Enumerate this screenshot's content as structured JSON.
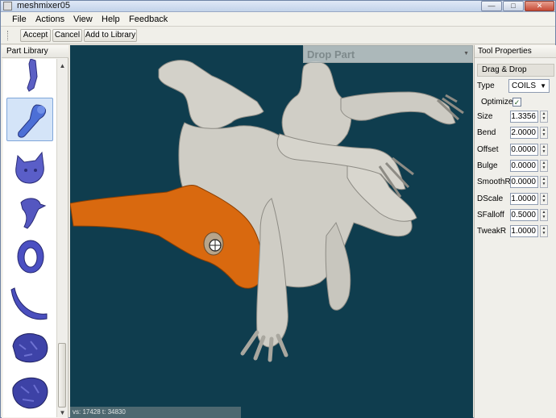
{
  "window": {
    "title": "meshmixer05"
  },
  "menu": {
    "items": [
      "File",
      "Actions",
      "View",
      "Help",
      "Feedback"
    ]
  },
  "toolbar": {
    "accept": "Accept",
    "cancel": "Cancel",
    "add_to_library": "Add to Library"
  },
  "part_library": {
    "title": "Part Library",
    "parts": [
      {
        "icon": "leg-part-icon",
        "selected": false
      },
      {
        "icon": "arm-part-icon",
        "selected": true
      },
      {
        "icon": "cat-head-part-icon",
        "selected": false
      },
      {
        "icon": "bird-head-part-icon",
        "selected": false
      },
      {
        "icon": "ring-part-icon",
        "selected": false
      },
      {
        "icon": "horn-part-icon",
        "selected": false
      },
      {
        "icon": "rock-lump-part-icon",
        "selected": false
      },
      {
        "icon": "rock-lump-2-part-icon",
        "selected": false
      }
    ]
  },
  "viewport": {
    "drop_panel_title": "Drop Part",
    "status": "vs: 17428  t: 34830",
    "colors": {
      "background": "#0f3d4e",
      "mesh": "#d2d0c8",
      "highlight": "#d96a12"
    }
  },
  "tool_properties": {
    "title": "Tool Properties",
    "section": "Drag & Drop",
    "type_label": "Type",
    "type_value": "COILS",
    "optimize_label": "Optimize",
    "optimize_checked": true,
    "params": [
      {
        "label": "Size",
        "value": "1.3356"
      },
      {
        "label": "Bend",
        "value": "2.0000"
      },
      {
        "label": "Offset",
        "value": "0.0000"
      },
      {
        "label": "Bulge",
        "value": "0.0000"
      },
      {
        "label": "SmoothR",
        "value": "0.0000"
      },
      {
        "label": "DScale",
        "value": "1.0000"
      },
      {
        "label": "SFalloff",
        "value": "0.5000"
      },
      {
        "label": "TweakR",
        "value": "1.0000"
      }
    ]
  }
}
